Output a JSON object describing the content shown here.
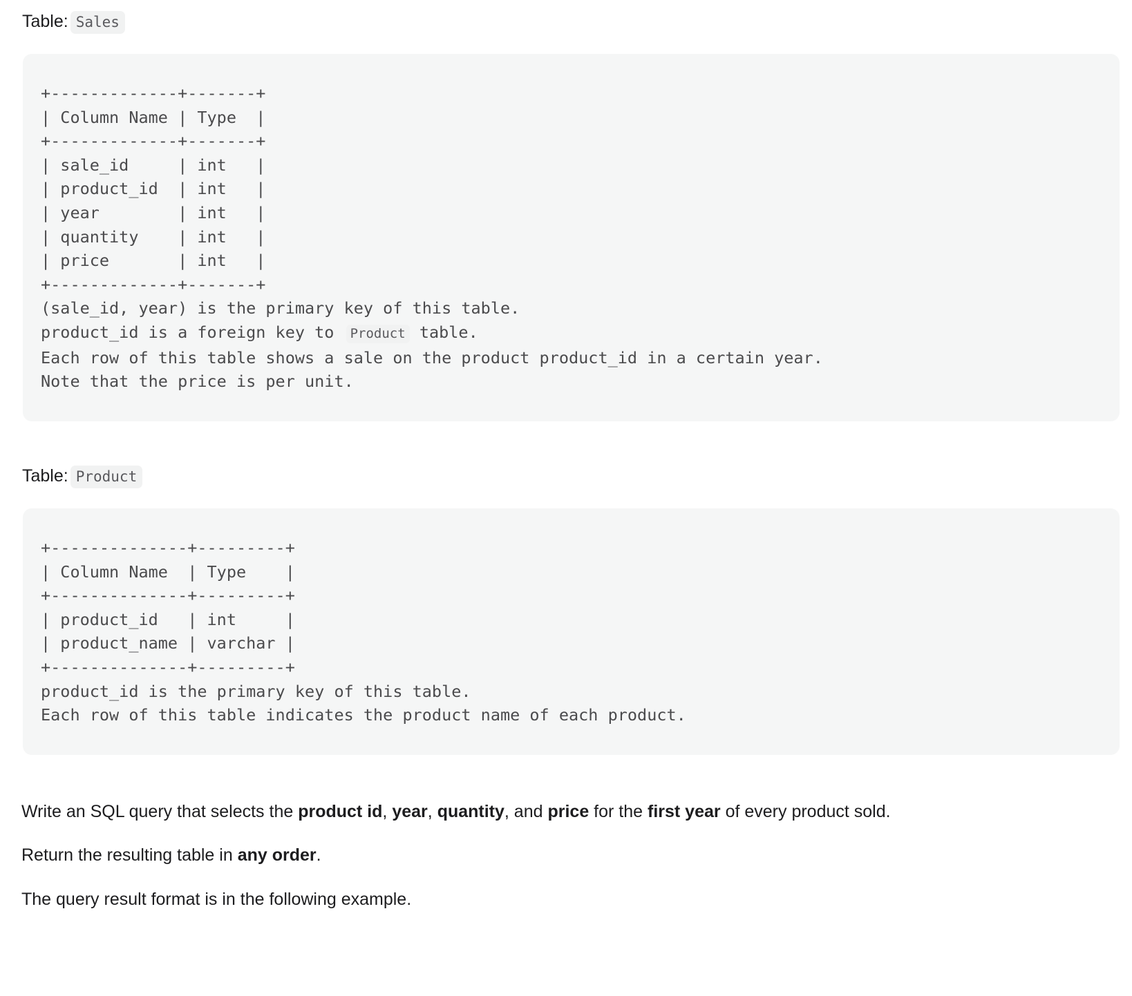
{
  "sections": [
    {
      "label_prefix": "Table:",
      "table_name": "Sales",
      "code": "+-------------+-------+\n| Column Name | Type  |\n+-------------+-------+\n| sale_id     | int   |\n| product_id  | int   |\n| year        | int   |\n| quantity    | int   |\n| price       | int   |\n+-------------+-------+",
      "notes": [
        "(sale_id, year) is the primary key of this table.",
        "Each row of this table shows a sale on the product product_id in a certain year.",
        "Note that the price is per unit."
      ],
      "fk_note_before": "product_id is a foreign key to ",
      "fk_note_code": "Product",
      "fk_note_after": " table."
    },
    {
      "label_prefix": "Table:",
      "table_name": "Product",
      "code": "+--------------+---------+\n| Column Name  | Type    |\n+--------------+---------+\n| product_id   | int     |\n| product_name | varchar |\n+--------------+---------+",
      "notes": [
        "product_id is the primary key of this table.",
        "Each row of this table indicates the product name of each product."
      ]
    }
  ],
  "prompt": {
    "line1_a": "Write an SQL query that selects the ",
    "line1_b1": "product id",
    "line1_c1": ", ",
    "line1_b2": "year",
    "line1_c2": ", ",
    "line1_b3": "quantity",
    "line1_c3": ", and ",
    "line1_b4": "price",
    "line1_c4": " for the ",
    "line1_b5": "first year",
    "line1_c5": " of every product sold.",
    "line2_a": "Return the resulting table in ",
    "line2_b": "any order",
    "line2_c": ".",
    "line3": "The query result format is in the following example."
  },
  "colors": {
    "code_block_bg": "#f5f6f6",
    "code_text": "#4b4b4d",
    "inline_code_bg": "#f1f2f2",
    "inline_code_text": "#5a5a5e",
    "body_text": "#1d1d1f",
    "page_bg": "#ffffff"
  }
}
